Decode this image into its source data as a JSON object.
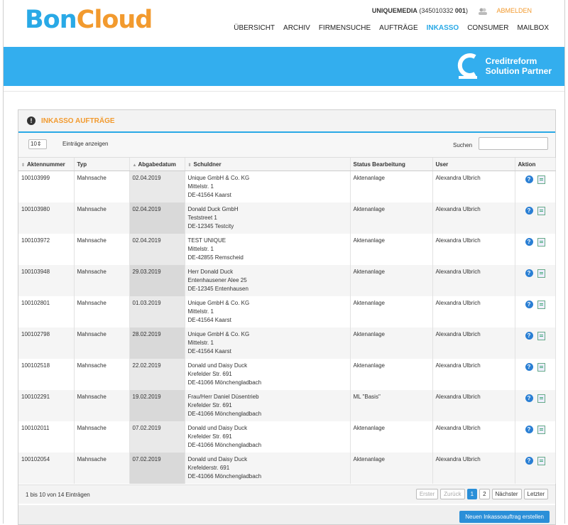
{
  "header": {
    "logo": {
      "part1": "Bon",
      "part2": "Cloud"
    },
    "account": {
      "name": "UNIQUEMEDIA",
      "id_prefix": "(345010332 ",
      "id_bold": "001",
      "id_suffix": ")",
      "logout_label": "ABMELDEN"
    },
    "nav": [
      "ÜBERSICHT",
      "ARCHIV",
      "FIRMENSUCHE",
      "AUFTRÄGE",
      "INKASSO",
      "CONSUMER",
      "MAILBOX"
    ],
    "active_nav": "INKASSO"
  },
  "banner": {
    "line1": "Creditreform",
    "line2": "Solution Partner",
    "bg_color": "#33aeee"
  },
  "panel": {
    "title": "INKASSO AUFTRÄGE",
    "length_value": "10",
    "length_label": "Einträge anzeigen",
    "search_label": "Suchen",
    "search_value": ""
  },
  "table": {
    "columns": [
      "Aktennummer",
      "Typ",
      "Abgabedatum",
      "Schuldner",
      "Status Bearbeitung",
      "User",
      "Aktion"
    ],
    "rows": [
      {
        "nr": "100103999",
        "typ": "Mahnsache",
        "datum": "02.04.2019",
        "s1": "Unique GmbH & Co. KG",
        "s2": "Mittelstr. 1",
        "s3": "DE-41564 Kaarst",
        "status": "Aktenanlage",
        "user": "Alexandra Ulbrich"
      },
      {
        "nr": "100103980",
        "typ": "Mahnsache",
        "datum": "02.04.2019",
        "s1": "Donald Duck GmbH",
        "s2": "Teststreet 1",
        "s3": "DE-12345 Testcity",
        "status": "Aktenanlage",
        "user": "Alexandra Ulbrich"
      },
      {
        "nr": "100103972",
        "typ": "Mahnsache",
        "datum": "02.04.2019",
        "s1": "TEST UNIQUE",
        "s2": "Mittelstr. 1",
        "s3": "DE-42855 Remscheid",
        "status": "Aktenanlage",
        "user": "Alexandra Ulbrich"
      },
      {
        "nr": "100103948",
        "typ": "Mahnsache",
        "datum": "29.03.2019",
        "s1": "Herr Donald Duck",
        "s2": "Entenhausener Alee 25",
        "s3": "DE-12345 Entenhausen",
        "status": "Aktenanlage",
        "user": "Alexandra Ulbrich"
      },
      {
        "nr": "100102801",
        "typ": "Mahnsache",
        "datum": "01.03.2019",
        "s1": "Unique GmbH & Co. KG",
        "s2": "Mittelstr. 1",
        "s3": "DE-41564 Kaarst",
        "status": "Aktenanlage",
        "user": "Alexandra Ulbrich"
      },
      {
        "nr": "100102798",
        "typ": "Mahnsache",
        "datum": "28.02.2019",
        "s1": "Unique GmbH & Co. KG",
        "s2": "Mittelstr. 1",
        "s3": "DE-41564 Kaarst",
        "status": "Aktenanlage",
        "user": "Alexandra Ulbrich"
      },
      {
        "nr": "100102518",
        "typ": "Mahnsache",
        "datum": "22.02.2019",
        "s1": "Donald und Daisy Duck",
        "s2": "Krefelder Str. 691",
        "s3": "DE-41066 Mönchengladbach",
        "status": "Aktenanlage",
        "user": "Alexandra Ulbrich"
      },
      {
        "nr": "100102291",
        "typ": "Mahnsache",
        "datum": "19.02.2019",
        "s1": "Frau/Herr Daniel Düsentrieb",
        "s2": "Krefelder Str. 691",
        "s3": "DE-41066 Mönchengladbach",
        "status": "ML \"Basis\"",
        "user": "Alexandra Ulbrich"
      },
      {
        "nr": "100102011",
        "typ": "Mahnsache",
        "datum": "07.02.2019",
        "s1": "Donald und Daisy Duck",
        "s2": "Krefelder Str. 691",
        "s3": "DE-41066 Mönchengladbach",
        "status": "Aktenanlage",
        "user": "Alexandra Ulbrich"
      },
      {
        "nr": "100102054",
        "typ": "Mahnsache",
        "datum": "07.02.2019",
        "s1": "Donald und Daisy Duck",
        "s2": "Krefelderstr. 691",
        "s3": "DE-41066 Mönchengladbach",
        "status": "Aktenanlage",
        "user": "Alexandra Ulbrich"
      }
    ]
  },
  "footer": {
    "info": "1 bis 10 von 14 Einträgen",
    "first": "Erster",
    "prev": "Zurück",
    "page1": "1",
    "page2": "2",
    "next": "Nächster",
    "last": "Letzter"
  },
  "actions": {
    "new_button": "Neuen Inkassoauftrag erstellen"
  },
  "colors": {
    "accent": "#29a9e6",
    "orange": "#f29a2e",
    "button": "#2a8fd8"
  }
}
